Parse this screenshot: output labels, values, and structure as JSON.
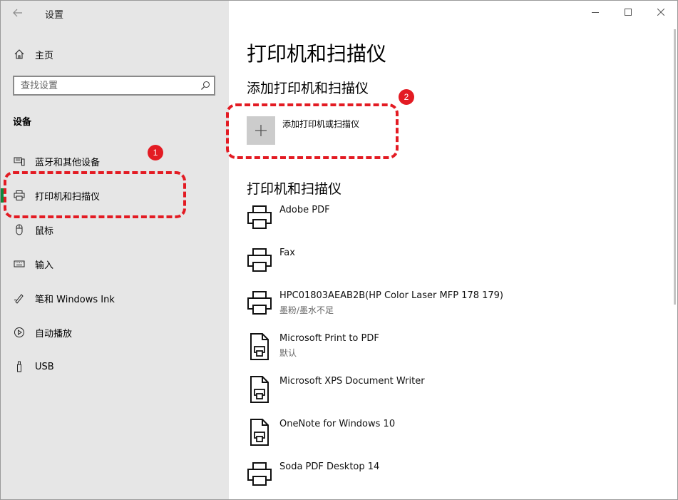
{
  "window": {
    "title": "设置",
    "controls": [
      "minimize",
      "maximize",
      "close"
    ]
  },
  "sidebar": {
    "home_label": "主页",
    "search_placeholder": "查找设置",
    "section_title": "设备",
    "items": [
      {
        "label": "蓝牙和其他设备",
        "icon": "bluetooth-devices-icon",
        "active": false
      },
      {
        "label": "打印机和扫描仪",
        "icon": "printer-icon",
        "active": true
      },
      {
        "label": "鼠标",
        "icon": "mouse-icon",
        "active": false
      },
      {
        "label": "输入",
        "icon": "keyboard-icon",
        "active": false
      },
      {
        "label": "笔和 Windows Ink",
        "icon": "pen-icon",
        "active": false
      },
      {
        "label": "自动播放",
        "icon": "autoplay-icon",
        "active": false
      },
      {
        "label": "USB",
        "icon": "usb-icon",
        "active": false
      }
    ]
  },
  "main": {
    "page_title": "打印机和扫描仪",
    "add_section_title": "添加打印机和扫描仪",
    "add_button_label": "添加打印机或扫描仪",
    "list_section_title": "打印机和扫描仪",
    "printers": [
      {
        "name": "Adobe PDF",
        "status": "",
        "icon": "printer-icon"
      },
      {
        "name": "Fax",
        "status": "",
        "icon": "printer-icon"
      },
      {
        "name": "HPC01803AEAB2B(HP Color Laser MFP 178 179)",
        "status": "墨粉/墨水不足",
        "icon": "printer-icon"
      },
      {
        "name": "Microsoft Print to PDF",
        "status": "默认",
        "icon": "document-printer-icon"
      },
      {
        "name": "Microsoft XPS Document Writer",
        "status": "",
        "icon": "document-printer-icon"
      },
      {
        "name": "OneNote for Windows 10",
        "status": "",
        "icon": "document-printer-icon"
      },
      {
        "name": "Soda PDF Desktop 14",
        "status": "",
        "icon": "printer-icon"
      }
    ]
  },
  "annotations": {
    "badge_1": "1",
    "badge_2": "2",
    "color": "#e31b23"
  },
  "colors": {
    "sidebar_bg": "#e6e6e6",
    "accent_active": "#10893e",
    "add_tile_bg": "#cccccc"
  }
}
